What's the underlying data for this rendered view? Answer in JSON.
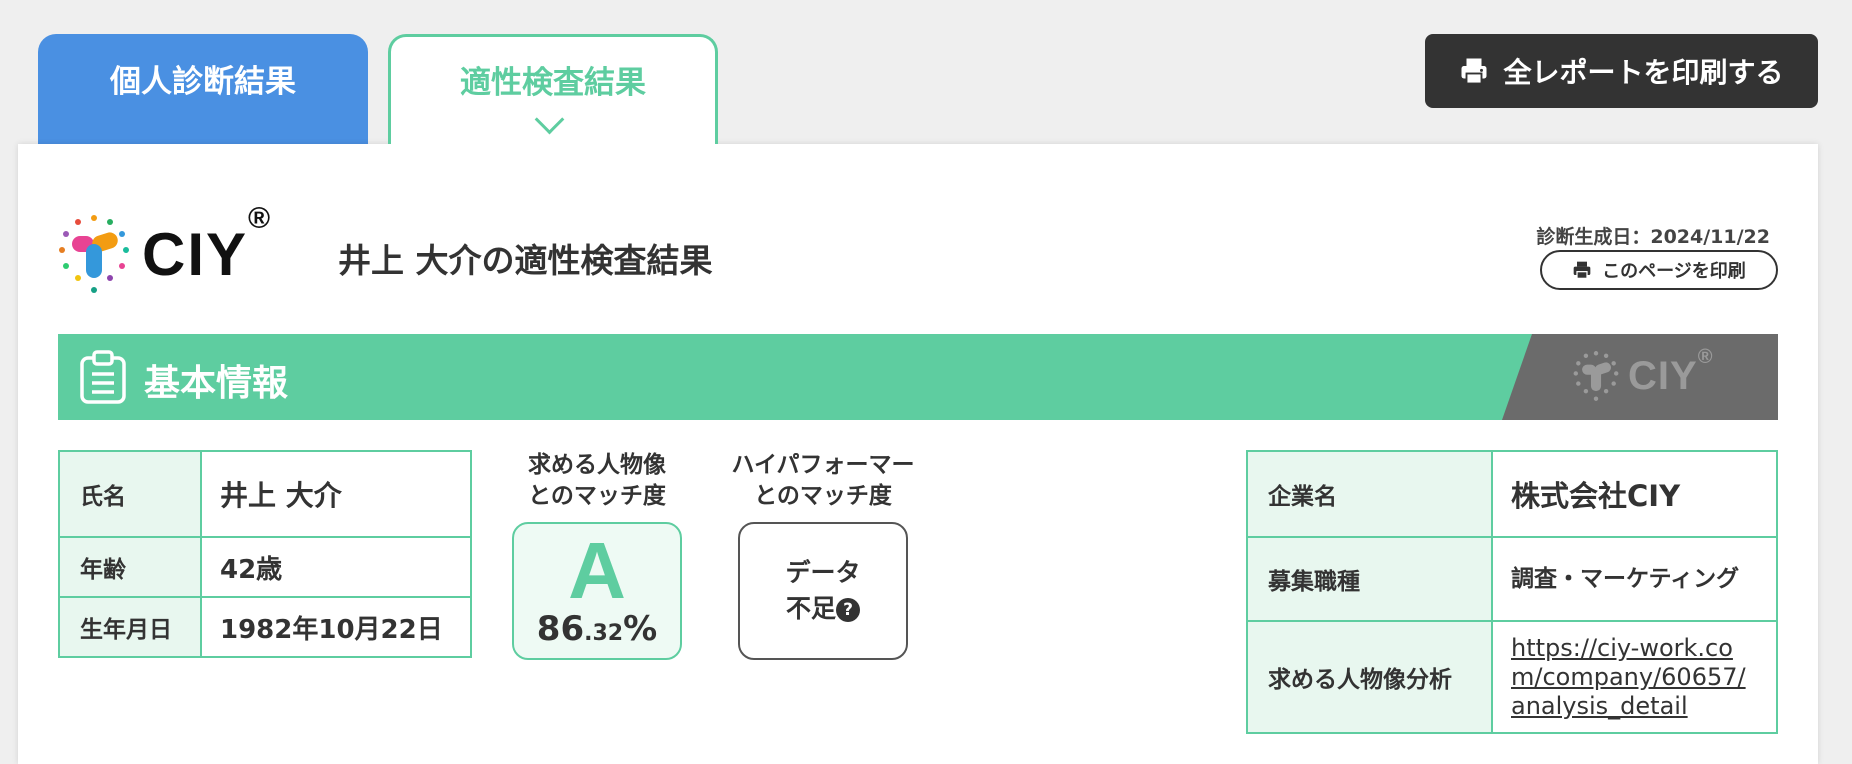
{
  "tabs": {
    "personal": "個人診断結果",
    "aptitude": "適性検査結果"
  },
  "print_all_label": "全レポートを印刷する",
  "header": {
    "logo_text": "CIY",
    "logo_reg": "®",
    "title": "井上 大介の適性検査結果",
    "generated_date": "診断生成日：2024/11/22",
    "print_page_label": "このページを印刷"
  },
  "section": {
    "title": "基本情報",
    "logo_text": "CIY",
    "logo_reg": "®"
  },
  "person": {
    "name_label": "氏名",
    "name_value": "井上 大介",
    "age_label": "年齢",
    "age_value": "42歳",
    "birth_label": "生年月日",
    "birth_value": "1982年10月22日"
  },
  "match_ideal": {
    "label_line1": "求める人物像",
    "label_line2": "とのマッチ度",
    "grade": "A",
    "pct_int": "86",
    "pct_dec": ".32",
    "pct_sign": "%"
  },
  "match_high": {
    "label_line1": "ハイパフォーマー",
    "label_line2": "とのマッチ度",
    "status_line1": "データ",
    "status_line2": "不足",
    "help_icon": "?"
  },
  "company": {
    "name_label": "企業名",
    "name_value": "株式会社CIY",
    "job_label": "募集職種",
    "job_value": "調査・マーケティング",
    "analysis_label": "求める人物像分析",
    "analysis_url": "https://ciy-work.com/company/60657/analysis_detail"
  },
  "colors": {
    "accent_green": "#5ecda0",
    "tab_blue": "#4a90e2",
    "dark": "#333333"
  }
}
